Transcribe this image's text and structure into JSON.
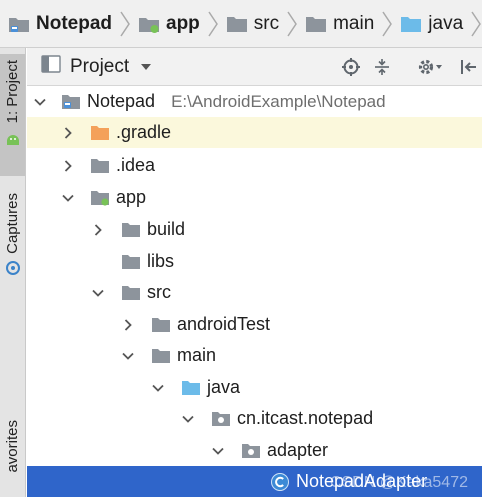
{
  "breadcrumb": {
    "items": [
      {
        "label": "Notepad",
        "icon": "project-icon",
        "bold": true
      },
      {
        "label": "app",
        "icon": "module-folder-icon",
        "bold": true
      },
      {
        "label": "src",
        "icon": "folder-icon",
        "bold": false
      },
      {
        "label": "main",
        "icon": "folder-icon",
        "bold": false
      },
      {
        "label": "java",
        "icon": "source-folder-icon",
        "bold": false
      }
    ]
  },
  "stripe": {
    "project_tab": "1: Project",
    "captures_tab": "Captures",
    "favorites_tab": "avorites"
  },
  "header": {
    "view_title": "Project"
  },
  "tree": {
    "root_label": "Notepad",
    "root_path": "E:\\AndroidExample\\Notepad",
    "rows": {
      "gradle": ".gradle",
      "idea": ".idea",
      "app": "app",
      "build": "build",
      "libs": "libs",
      "src": "src",
      "androidTest": "androidTest",
      "main": "main",
      "java": "java",
      "package": "cn.itcast.notepad",
      "adapter": "adapter",
      "selected": "NotepadAdapter"
    }
  },
  "watermark": "CSDN @Kaka5472",
  "colors": {
    "selection": "#2f65ca",
    "highlight_row": "#fbf8dc",
    "folder_gray": "#9aa0a6",
    "folder_orange": "#f4a15a",
    "folder_blue": "#6cbbe9",
    "android_green": "#78c257"
  }
}
